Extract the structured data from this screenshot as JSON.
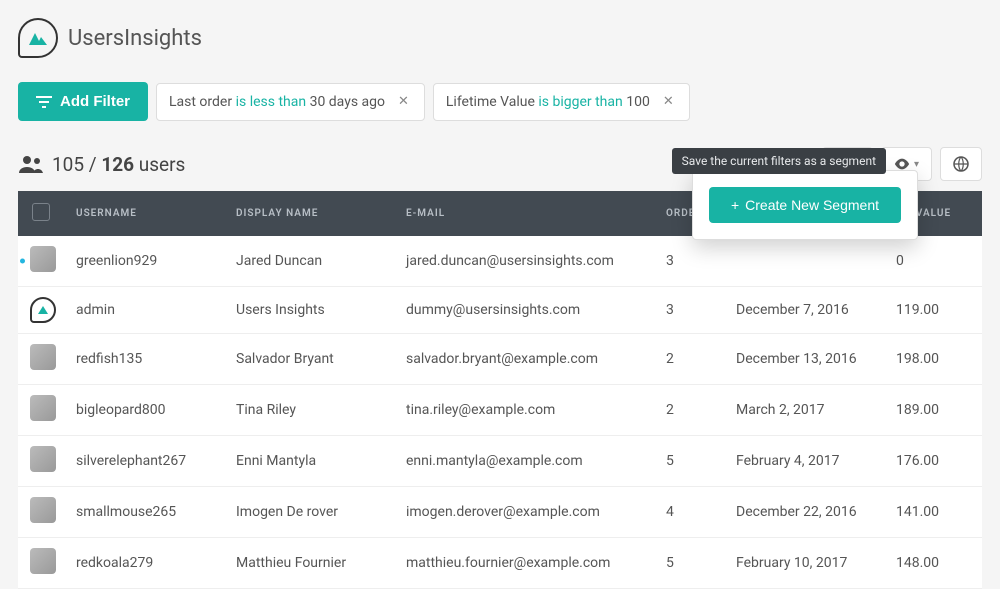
{
  "brand": "UsersInsights",
  "add_filter_label": "Add Filter",
  "filters": [
    {
      "field": "Last order",
      "operator": "is less than",
      "value": "30 days ago"
    },
    {
      "field": "Lifetime Value",
      "operator": "is bigger than",
      "value": "100"
    }
  ],
  "count": {
    "shown": "105",
    "sep": "/",
    "total": "126",
    "suffix": "users"
  },
  "tooltip": "Save the current filters as a segment",
  "create_segment_label": "Create New Segment",
  "table": {
    "headers": {
      "username": "USERNAME",
      "display_name": "DISPLAY NAME",
      "email": "E-MAIL",
      "orders": "ORDE",
      "last_order": "",
      "lifetime_value": "ME VALUE"
    },
    "rows": [
      {
        "online": true,
        "avatar": "a1",
        "username": "greenlion929",
        "display_name": "Jared Duncan",
        "email": "jared.duncan@usersinsights.com",
        "orders": "3",
        "last_order": "",
        "lifetime_value": "0"
      },
      {
        "online": false,
        "avatar": "admin",
        "username": "admin",
        "display_name": "Users Insights",
        "email": "dummy@usersinsights.com",
        "orders": "3",
        "last_order": "December 7, 2016",
        "lifetime_value": "119.00"
      },
      {
        "online": false,
        "avatar": "a3",
        "username": "redfish135",
        "display_name": "Salvador Bryant",
        "email": "salvador.bryant@example.com",
        "orders": "2",
        "last_order": "December 13, 2016",
        "lifetime_value": "198.00"
      },
      {
        "online": false,
        "avatar": "a4",
        "username": "bigleopard800",
        "display_name": "Tina Riley",
        "email": "tina.riley@example.com",
        "orders": "2",
        "last_order": "March 2, 2017",
        "lifetime_value": "189.00"
      },
      {
        "online": false,
        "avatar": "a5",
        "username": "silverelephant267",
        "display_name": "Enni Mantyla",
        "email": "enni.mantyla@example.com",
        "orders": "5",
        "last_order": "February 4, 2017",
        "lifetime_value": "176.00"
      },
      {
        "online": false,
        "avatar": "a6",
        "username": "smallmouse265",
        "display_name": "Imogen De rover",
        "email": "imogen.derover@example.com",
        "orders": "4",
        "last_order": "December 22, 2016",
        "lifetime_value": "141.00"
      },
      {
        "online": false,
        "avatar": "a7",
        "username": "redkoala279",
        "display_name": "Matthieu Fournier",
        "email": "matthieu.fournier@example.com",
        "orders": "5",
        "last_order": "February 10, 2017",
        "lifetime_value": "148.00"
      }
    ]
  }
}
